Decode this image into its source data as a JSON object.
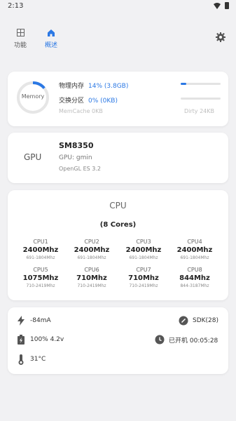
{
  "status": {
    "time": "2:13"
  },
  "nav": {
    "tabs": [
      {
        "label": "功能",
        "icon": "grid-icon"
      },
      {
        "label": "概述",
        "icon": "home-icon"
      }
    ]
  },
  "memory": {
    "ring_label": "Memory",
    "ram_label": "物理内存",
    "ram_value": "14% (3.8GB)",
    "ram_fraction": 0.14,
    "swap_label": "交换分区",
    "swap_value": "0% (0KB)",
    "swap_fraction": 0,
    "extra_left": "MemCache 0KB",
    "extra_right": "Dirty 24KB"
  },
  "gpu": {
    "tag": "GPU",
    "model": "SM8350",
    "name": "GPU: gmin",
    "gl": "OpenGL ES 3.2"
  },
  "cpu": {
    "title": "CPU",
    "cores_label": "(8 Cores)",
    "cores": [
      {
        "name": "CPU1",
        "freq": "2400Mhz",
        "range": "691-1804Mhz"
      },
      {
        "name": "CPU2",
        "freq": "2400Mhz",
        "range": "691-1804Mhz"
      },
      {
        "name": "CPU3",
        "freq": "2400Mhz",
        "range": "691-1804Mhz"
      },
      {
        "name": "CPU4",
        "freq": "2400Mhz",
        "range": "691-1804Mhz"
      },
      {
        "name": "CPU5",
        "freq": "1075Mhz",
        "range": "710-2419Mhz"
      },
      {
        "name": "CPU6",
        "freq": "710Mhz",
        "range": "710-2419Mhz"
      },
      {
        "name": "CPU7",
        "freq": "710Mhz",
        "range": "710-2419Mhz"
      },
      {
        "name": "CPU8",
        "freq": "844Mhz",
        "range": "844-3187Mhz"
      }
    ]
  },
  "battery": {
    "current": "-84mA",
    "sdk": "SDK(28)",
    "level": "100% 4.2v",
    "uptime": "已开机 00:05:28",
    "temp": "31°C"
  },
  "colors": {
    "accent": "#2b78e4",
    "background": "#f1f1f3"
  }
}
